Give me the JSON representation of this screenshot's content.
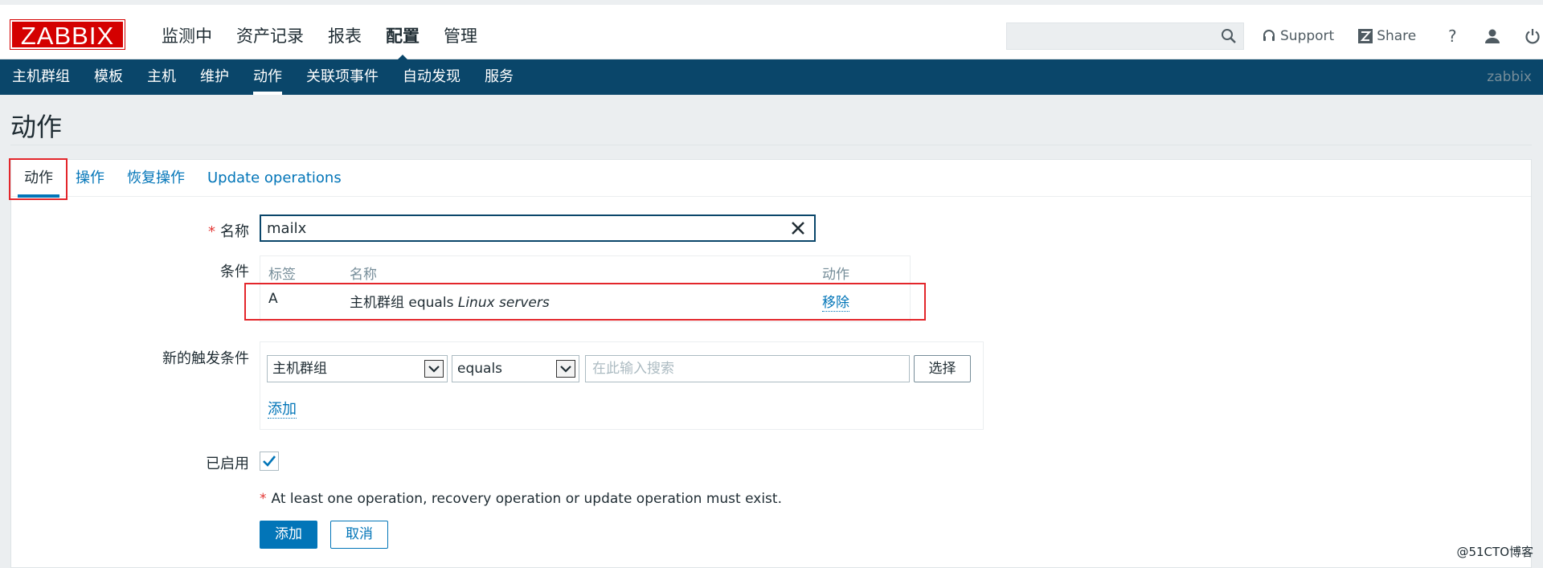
{
  "header": {
    "logo_text": "ZABBIX",
    "main_nav": [
      "监测中",
      "资产记录",
      "报表",
      "配置",
      "管理"
    ],
    "active_main": "配置",
    "search_placeholder": "",
    "support_label": "Support",
    "share_label": "Share",
    "help_label": "?"
  },
  "subnav": {
    "items": [
      "主机群组",
      "模板",
      "主机",
      "维护",
      "动作",
      "关联项事件",
      "自动发现",
      "服务"
    ],
    "active": "动作",
    "user": "zabbix"
  },
  "page": {
    "title": "动作"
  },
  "tabs": [
    "动作",
    "操作",
    "恢复操作",
    "Update operations"
  ],
  "form": {
    "name_label": "名称",
    "name_value": "mailx",
    "conditions_label": "条件",
    "conditions_table": {
      "headers": [
        "标签",
        "名称",
        "动作"
      ],
      "rows": [
        {
          "label": "A",
          "name_prefix": "主机群组 equals ",
          "name_value": "Linux servers",
          "action": "移除"
        }
      ]
    },
    "new_condition_label": "新的触发条件",
    "condition_type": "主机群组",
    "operator": "equals",
    "search_placeholder": "在此输入搜索",
    "select_button": "选择",
    "add_link": "添加",
    "enabled_label": "已启用",
    "enabled": true,
    "warning_star": "*",
    "warning_text": "At least one operation, recovery operation or update operation must exist.",
    "add_button": "添加",
    "cancel_button": "取消"
  },
  "watermark": "@51CTO博客",
  "colors": {
    "brand_red": "#d40000",
    "nav_dark": "#0a466a",
    "link_blue": "#0275b8",
    "highlight_red": "#e3262b"
  }
}
